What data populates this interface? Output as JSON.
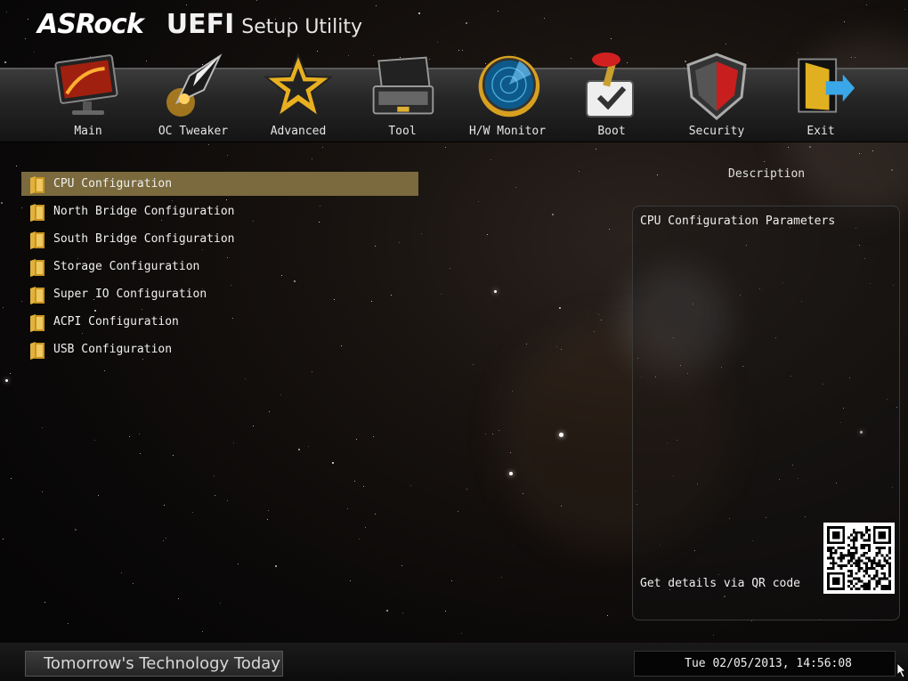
{
  "header": {
    "brand": "ASRock",
    "product": "UEFI",
    "subtitle": "Setup Utility"
  },
  "nav": [
    {
      "label": "Main",
      "icon": "monitor-icon"
    },
    {
      "label": "OC Tweaker",
      "icon": "rocket-icon"
    },
    {
      "label": "Advanced",
      "icon": "star-icon"
    },
    {
      "label": "Tool",
      "icon": "toolbox-icon"
    },
    {
      "label": "H/W Monitor",
      "icon": "radar-icon"
    },
    {
      "label": "Boot",
      "icon": "joystick-icon"
    },
    {
      "label": "Security",
      "icon": "shield-icon"
    },
    {
      "label": "Exit",
      "icon": "exit-door-icon"
    }
  ],
  "menu": {
    "selected_index": 0,
    "items": [
      {
        "label": "CPU Configuration"
      },
      {
        "label": "North Bridge Configuration"
      },
      {
        "label": "South Bridge Configuration"
      },
      {
        "label": "Storage Configuration"
      },
      {
        "label": "Super IO Configuration"
      },
      {
        "label": "ACPI Configuration"
      },
      {
        "label": "USB Configuration"
      }
    ]
  },
  "description": {
    "title": "Description",
    "text": "CPU Configuration Parameters",
    "qr_hint": "Get details via QR code"
  },
  "footer": {
    "slogan": "Tomorrow's Technology Today",
    "datetime": "Tue 02/05/2013, 14:56:08"
  },
  "colors": {
    "selected_bg": "#7a6a3e",
    "folder": "#e0b23c",
    "navbar": "#2a2a2a"
  }
}
